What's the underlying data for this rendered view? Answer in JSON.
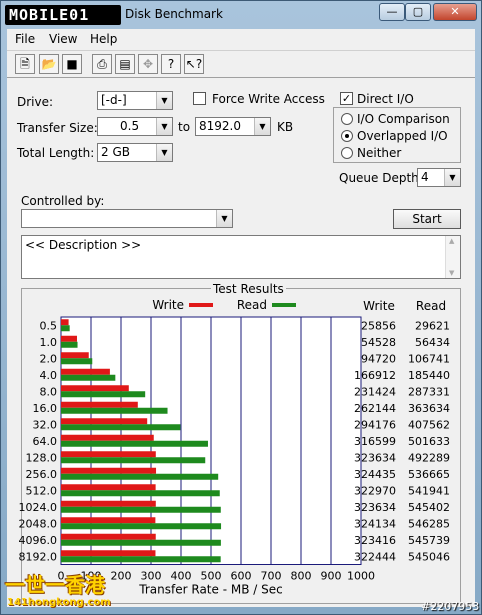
{
  "window": {
    "logo": "MOBILE01",
    "title": "Disk Benchmark",
    "minimize": "—",
    "maximize": "▢",
    "close": "✕"
  },
  "menu": [
    "File",
    "View",
    "Help"
  ],
  "toolbar_icons": [
    "new-file-icon",
    "open-folder-icon",
    "save-icon",
    "print-icon",
    "print-preview-icon",
    "move-icon",
    "help-icon",
    "context-help-icon"
  ],
  "drive": {
    "label": "Drive:",
    "value": "[-d-]"
  },
  "force_write": {
    "label": "Force Write Access",
    "checked": false
  },
  "transfer_size": {
    "label": "Transfer Size:",
    "from": "0.5",
    "to_label": "to",
    "to": "8192.0",
    "unit": "KB"
  },
  "total_length": {
    "label": "Total Length:",
    "value": "2 GB"
  },
  "direct_io": {
    "label": "Direct I/O",
    "checked": true
  },
  "mode_options": [
    {
      "label": "I/O Comparison",
      "selected": false
    },
    {
      "label": "Overlapped I/O",
      "selected": true
    },
    {
      "label": "Neither",
      "selected": false
    }
  ],
  "queue_depth": {
    "label": "Queue Depth:",
    "value": "4"
  },
  "controlled_by": {
    "label": "Controlled by:",
    "value": ""
  },
  "start_button": "Start",
  "description": "<< Description >>",
  "test_results_label": "Test Results",
  "colors": {
    "write": "#e01818",
    "read": "#1e8a1e",
    "grid": "#1a1a7a"
  },
  "chart_data": {
    "type": "bar",
    "orientation": "horizontal",
    "xlabel": "Transfer Rate - MB / Sec",
    "xlim": [
      0,
      1000
    ],
    "xticks": [
      0,
      100,
      200,
      300,
      400,
      500,
      600,
      700,
      800,
      900,
      1000
    ],
    "grid": true,
    "categories": [
      "0.5",
      "1.0",
      "2.0",
      "4.0",
      "8.0",
      "16.0",
      "32.0",
      "64.0",
      "128.0",
      "256.0",
      "512.0",
      "1024.0",
      "2048.0",
      "4096.0",
      "8192.0"
    ],
    "series": [
      {
        "name": "Write",
        "values": [
          25.3,
          53.3,
          92.5,
          163.0,
          226.0,
          256.0,
          287.3,
          309.2,
          316.0,
          316.8,
          315.4,
          316.0,
          314.6,
          315.8,
          314.9
        ]
      },
      {
        "name": "Read",
        "values": [
          28.9,
          55.1,
          104.2,
          181.1,
          280.6,
          355.1,
          398.0,
          489.9,
          480.8,
          524.0,
          529.2,
          532.6,
          533.5,
          533.0,
          532.3
        ]
      }
    ],
    "table_headers": [
      "Write",
      "Read"
    ],
    "table_rows": [
      [
        "25856",
        "29621"
      ],
      [
        "54528",
        "56434"
      ],
      [
        "94720",
        "106741"
      ],
      [
        "166912",
        "185440"
      ],
      [
        "231424",
        "287331"
      ],
      [
        "262144",
        "363634"
      ],
      [
        "294176",
        "407562"
      ],
      [
        "316599",
        "501633"
      ],
      [
        "323634",
        "492289"
      ],
      [
        "324435",
        "536665"
      ],
      [
        "322970",
        "541941"
      ],
      [
        "323634",
        "545402"
      ],
      [
        "324134",
        "546285"
      ],
      [
        "323416",
        "545739"
      ],
      [
        "322444",
        "545046"
      ]
    ]
  },
  "watermark": {
    "brand_cn": "一世一香港",
    "brand_url": "141hongkong.com",
    "post_id": "#2207953"
  }
}
